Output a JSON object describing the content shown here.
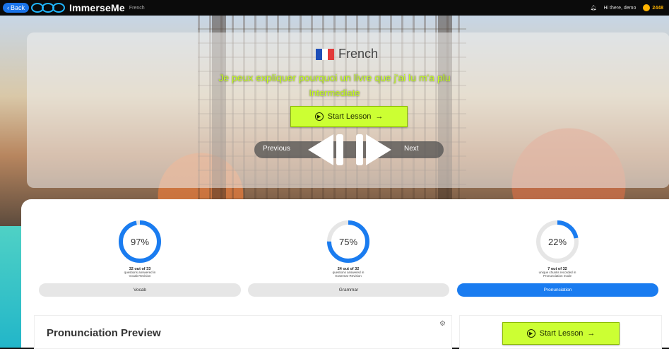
{
  "topbar": {
    "back_label": "Back",
    "brand": "ImmerseMe",
    "breadcrumb": "French",
    "greeting": "Hi there, demo",
    "coins": "2448"
  },
  "hero": {
    "language": "French",
    "sentence": "Je peux expliquer pourquoi un livre que j'ai lu m'a plu",
    "level": "Intermediate",
    "start_label": "Start Lesson",
    "prev_label": "Previous",
    "next_label": "Next"
  },
  "stats": [
    {
      "percent": 97,
      "percent_label": "97%",
      "count": "32 out of 33",
      "desc1": "questions answered in",
      "desc2": "Vocab Revision"
    },
    {
      "percent": 75,
      "percent_label": "75%",
      "count": "24 out of 32",
      "desc1": "questions answered in",
      "desc2": "Grammar Revision"
    },
    {
      "percent": 22,
      "percent_label": "22%",
      "count": "7 out of 32",
      "desc1": "unique chunks recorded in",
      "desc2": "Pronunciation mode"
    }
  ],
  "tabs": [
    {
      "label": "Vocab",
      "active": false
    },
    {
      "label": "Grammar",
      "active": false
    },
    {
      "label": "Pronunciation",
      "active": true
    }
  ],
  "preview": {
    "title": "Pronunciation Preview",
    "start_label": "Start Lesson"
  },
  "colors": {
    "accent_blue": "#1a7cf0",
    "lime": "#ccff33",
    "ring_track": "#e6e6e6"
  }
}
